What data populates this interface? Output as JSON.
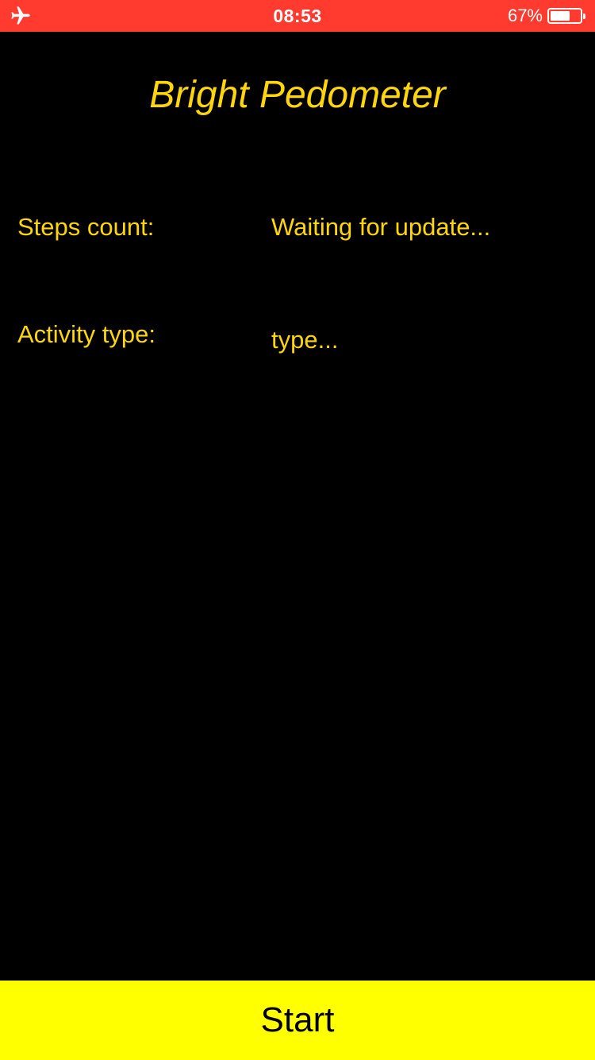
{
  "status_bar": {
    "time": "08:53",
    "battery_percent_label": "67%",
    "battery_level": 0.67,
    "left_icon": "airplane-icon",
    "background_color": "#ff3b30"
  },
  "header": {
    "title": "Bright Pedometer"
  },
  "stats": {
    "steps_label": "Steps count:",
    "steps_value": "Waiting for update...",
    "activity_label": "Activity type:",
    "activity_value": "type..."
  },
  "footer": {
    "start_label": "Start"
  },
  "colors": {
    "background": "#000000",
    "text_accent": "#ffd60a",
    "button_background": "#ffff00",
    "button_text": "#000000"
  }
}
